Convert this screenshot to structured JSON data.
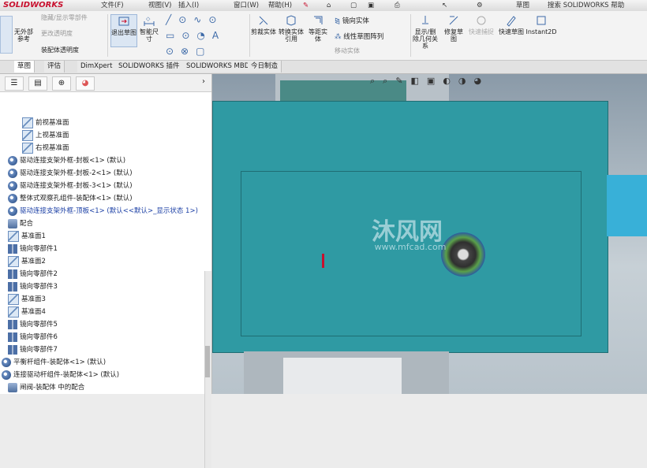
{
  "app": {
    "logo": "SOLIDWORKS"
  },
  "menubar": [
    "文件(F)",
    "视图(V)",
    "插入(I)",
    "窗口(W)",
    "帮助(H)",
    "草图",
    "搜索 SOLIDWORKS 帮助"
  ],
  "ribbon": {
    "left_buttons": [
      {
        "label": "无外部参考"
      },
      {
        "label": "隐藏/显示零部件"
      },
      {
        "label": "更改透明度"
      },
      {
        "label": "装配体透明度"
      }
    ],
    "exit_sketch": "退出草图",
    "smart_dim": "智能尺寸",
    "trim": "剪裁实体",
    "convert": "转换实体引用",
    "offset": "等距实体",
    "mirror": "镜向实体",
    "linear_pattern": "线性草图阵列",
    "move": "移动实体",
    "show_relations": "显示/删除几何关系",
    "repair": "修复草图",
    "quick_snap": "快速捕捉",
    "rapid_sketch": "快速草图",
    "instant2d": "Instant2D"
  },
  "tabs": [
    "草图",
    "评估",
    "DimXpert",
    "SOLIDWORKS 插件",
    "SOLIDWORKS MBD",
    "今日制造"
  ],
  "tree": [
    {
      "label": "前视基准面",
      "icon": "plane-icon"
    },
    {
      "label": "上视基准面",
      "icon": "plane-icon"
    },
    {
      "label": "右视基准面",
      "icon": "plane-icon"
    },
    {
      "label": "驱动连接支架外框-封板<1> (默认)",
      "icon": "part-icon"
    },
    {
      "label": "驱动连接支架外框-封板-2<1> (默认)",
      "icon": "part-icon"
    },
    {
      "label": "驱动连接支架外框-封板-3<1> (默认)",
      "icon": "part-icon"
    },
    {
      "label": "整体式观察孔组件-装配体<1> (默认)",
      "icon": "part-icon"
    },
    {
      "label": "驱动连接支架外框-顶板<1> (默认<<默认>_显示状态 1>)",
      "icon": "part-icon",
      "active": true
    },
    {
      "label": "配合",
      "icon": "mate-icon"
    },
    {
      "label": "基准面1",
      "icon": "plane-icon"
    },
    {
      "label": "镜向零部件1",
      "icon": "mirror-icon"
    },
    {
      "label": "基准面2",
      "icon": "plane-icon"
    },
    {
      "label": "镜向零部件2",
      "icon": "mirror-icon"
    },
    {
      "label": "镜向零部件3",
      "icon": "mirror-icon"
    },
    {
      "label": "基准面3",
      "icon": "plane-icon"
    },
    {
      "label": "基准面4",
      "icon": "plane-icon"
    },
    {
      "label": "镜向零部件5",
      "icon": "mirror-icon"
    },
    {
      "label": "镜向零部件6",
      "icon": "mirror-icon"
    },
    {
      "label": "镜向零部件7",
      "icon": "mirror-icon"
    },
    {
      "label": "平衡杆组件-装配体<1> (默认)",
      "icon": "asm-icon",
      "outdent": true
    },
    {
      "label": "连接驱动杆组件-装配体<1> (默认)",
      "icon": "asm-icon",
      "outdent": true
    },
    {
      "label": "闸阀-装配体 中的配合",
      "icon": "mate-icon"
    }
  ],
  "watermark": {
    "title": "沐风网",
    "url": "www.mfcad.com"
  },
  "colors": {
    "plate": "#2f9aa3",
    "accent_red": "#c8102e"
  }
}
